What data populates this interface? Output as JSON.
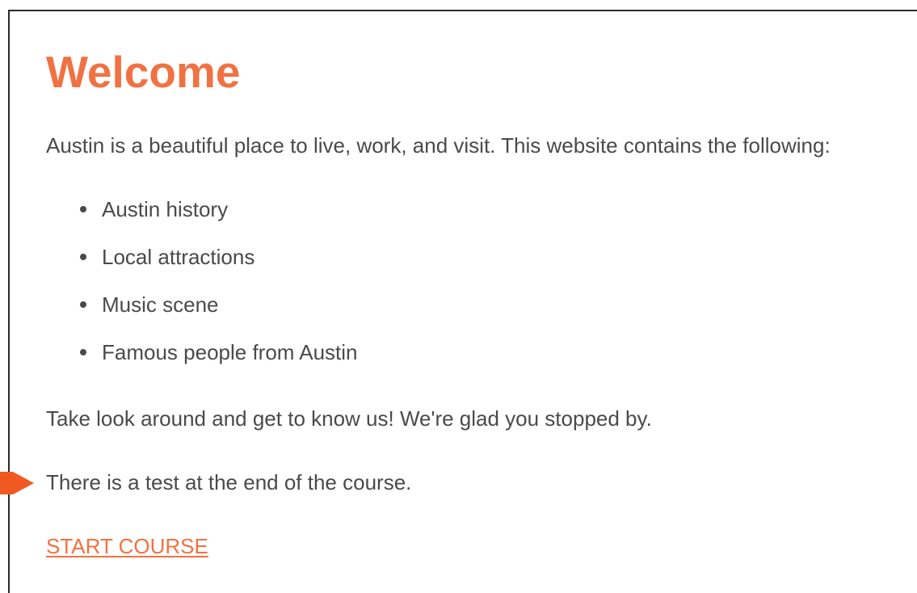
{
  "page": {
    "title": "Welcome",
    "intro": "Austin is a beautiful place to live, work, and visit. This website contains the following:",
    "list_items": [
      "Austin history",
      "Local attractions",
      "Music scene",
      "Famous people from Austin"
    ],
    "closing": "Take look around and get to know us! We're glad you stopped by.",
    "test_note": "There is a test at the end of the course.",
    "start_link": "START COURSE"
  },
  "colors": {
    "accent": "#f07242",
    "arrow": "#f05a22",
    "text": "#4a4a4a",
    "border": "#2b2b2b"
  },
  "icons": {
    "pointer": "arrow-right-icon"
  }
}
